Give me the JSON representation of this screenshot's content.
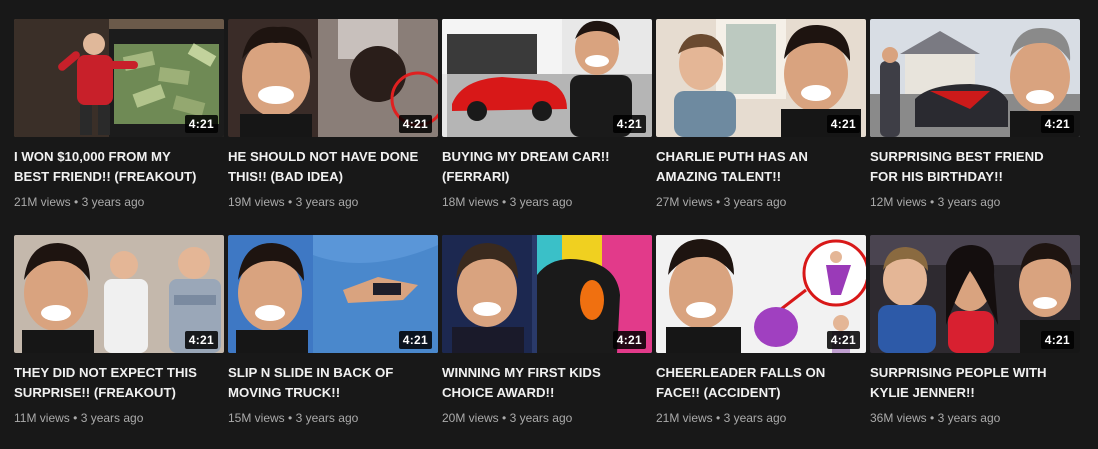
{
  "videos": [
    {
      "title": "I WON $10,000 FROM MY\nBEST FRIEND!! (FREAKOUT)",
      "views": "21M views",
      "age": "3 years ago",
      "duration": "4:21"
    },
    {
      "title": "HE SHOULD NOT HAVE DONE\nTHIS!! (BAD IDEA)",
      "views": "19M views",
      "age": "3 years ago",
      "duration": "4:21"
    },
    {
      "title": "BUYING MY DREAM CAR!!\n(FERRARI)",
      "views": "18M views",
      "age": "3 years ago",
      "duration": "4:21"
    },
    {
      "title": "CHARLIE PUTH HAS AN\nAMAZING TALENT!!",
      "views": "27M views",
      "age": "3 years ago",
      "duration": "4:21"
    },
    {
      "title": "SURPRISING BEST FRIEND\nFOR HIS BIRTHDAY!!",
      "views": "12M views",
      "age": "3 years ago",
      "duration": "4:21"
    },
    {
      "title": "THEY DID NOT EXPECT THIS\nSURPRISE!! (FREAKOUT)",
      "views": "11M views",
      "age": "3 years ago",
      "duration": "4:21"
    },
    {
      "title": "SLIP N SLIDE IN BACK OF\nMOVING TRUCK!!",
      "views": "15M views",
      "age": "3 years ago",
      "duration": "4:21"
    },
    {
      "title": "WINNING MY FIRST KIDS\nCHOICE AWARD!!",
      "views": "20M views",
      "age": "3 years ago",
      "duration": "4:21"
    },
    {
      "title": "CHEERLEADER FALLS ON\nFACE!! (ACCIDENT)",
      "views": "21M views",
      "age": "3 years ago",
      "duration": "4:21"
    },
    {
      "title": "SURPRISING PEOPLE WITH\nKYLIE JENNER!!",
      "views": "36M views",
      "age": "3 years ago",
      "duration": "4:21"
    }
  ],
  "meta_separator": "•",
  "colors": {
    "background": "#181818",
    "title": "#f1f1f1",
    "meta": "#aaaaaa",
    "duration_bg": "#000000"
  }
}
